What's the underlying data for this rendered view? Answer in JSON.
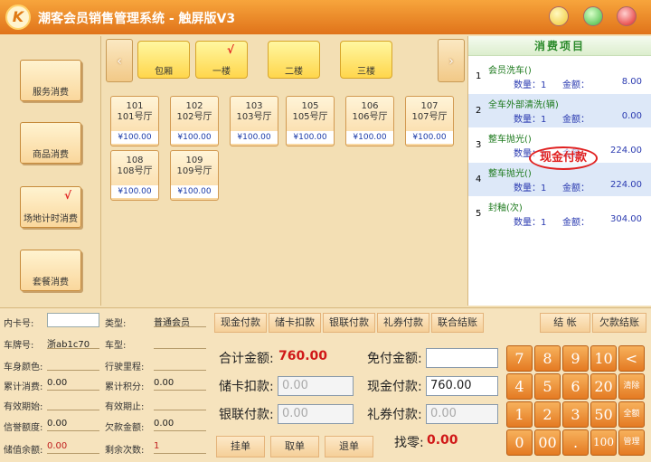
{
  "window": {
    "logo_letter": "K",
    "title": "潮客会员销售管理系统 - 触屏版V3"
  },
  "categories": [
    {
      "label": "服务消费",
      "checked": false
    },
    {
      "label": "商品消费",
      "checked": false
    },
    {
      "label": "场地计时消费",
      "checked": true
    },
    {
      "label": "套餐消费",
      "checked": false
    }
  ],
  "check_mark": "√",
  "floors": [
    {
      "label": "包厢",
      "checked": false
    },
    {
      "label": "一楼",
      "checked": true
    },
    {
      "label": "二楼",
      "checked": false
    },
    {
      "label": "三楼",
      "checked": false
    }
  ],
  "rooms": [
    {
      "code": "101",
      "name": "101号厅",
      "price": "¥100.00"
    },
    {
      "code": "102",
      "name": "102号厅",
      "price": "¥100.00"
    },
    {
      "code": "103",
      "name": "103号厅",
      "price": "¥100.00"
    },
    {
      "code": "105",
      "name": "105号厅",
      "price": "¥100.00"
    },
    {
      "code": "106",
      "name": "106号厅",
      "price": "¥100.00"
    },
    {
      "code": "107",
      "name": "107号厅",
      "price": "¥100.00"
    },
    {
      "code": "108",
      "name": "108号厅",
      "price": "¥100.00"
    },
    {
      "code": "109",
      "name": "109号厅",
      "price": "¥100.00"
    }
  ],
  "items_header": "消费项目",
  "items": [
    {
      "num": "1",
      "name": "会员洗车()",
      "qty_label": "数量：1",
      "amount_label": "金额：",
      "amount": "8.00"
    },
    {
      "num": "2",
      "name": "全车外部清洗(辆)",
      "qty_label": "数量：1",
      "amount_label": "金额：",
      "amount": "0.00"
    },
    {
      "num": "3",
      "name": "整车抛光()",
      "qty_label": "数量：1",
      "amount_label": "金额：",
      "amount": "224.00"
    },
    {
      "num": "4",
      "name": "整车抛光()",
      "qty_label": "数量：1",
      "amount_label": "金额：",
      "amount": "224.00"
    },
    {
      "num": "5",
      "name": "封釉(次)",
      "qty_label": "数量：1",
      "amount_label": "金额：",
      "amount": "304.00"
    }
  ],
  "stamp_text": "现金付款",
  "member": {
    "card_no_label": "内卡号:",
    "card_no": "",
    "type_label": "类型:",
    "type": "普通会员",
    "plate_label": "车牌号:",
    "plate": "浙ab1c70",
    "model_label": "车型:",
    "model": "",
    "color_label": "车身颜色:",
    "color": "",
    "mileage_label": "行驶里程:",
    "mileage": "",
    "total_spend_label": "累计消费:",
    "total_spend": "0.00",
    "total_points_label": "累计积分:",
    "total_points": "0.00",
    "valid_from_label": "有效期始:",
    "valid_from": "",
    "valid_to_label": "有效期止:",
    "valid_to": "",
    "credit_label": "信誉额度:",
    "credit": "0.00",
    "debt_label": "欠款金额:",
    "debt": "0.00",
    "balance_label": "储值余额:",
    "balance": "0.00",
    "remaining_label": "剩余次数:",
    "remaining": "1"
  },
  "pay_tabs": [
    "现金付款",
    "储卡扣款",
    "银联付款",
    "礼券付款",
    "联合结账"
  ],
  "checkout_label": "结 帐",
  "owe_checkout_label": "欠款结账",
  "payment": {
    "total_label": "合计金额:",
    "total": "760.00",
    "free_label": "免付金额:",
    "free": "",
    "card_label": "储卡扣款:",
    "card": "0.00",
    "cash_label": "现金付款:",
    "cash": "760.00",
    "union_label": "银联付款:",
    "union": "0.00",
    "coupon_label": "礼券付款:",
    "coupon": "0.00",
    "change_label": "找零:",
    "change": "0.00"
  },
  "actions": [
    "挂单",
    "取单",
    "退单"
  ],
  "keypad": [
    [
      "7",
      "8",
      "9",
      "10",
      "<—"
    ],
    [
      "4",
      "5",
      "6",
      "20",
      "清除"
    ],
    [
      "1",
      "2",
      "3",
      "50",
      "全额"
    ],
    [
      "0",
      "00",
      ".",
      "100",
      "管理"
    ]
  ],
  "colors": {
    "accent": "#e0731a",
    "stamp": "#e02020",
    "price": "#1a3aa8"
  }
}
